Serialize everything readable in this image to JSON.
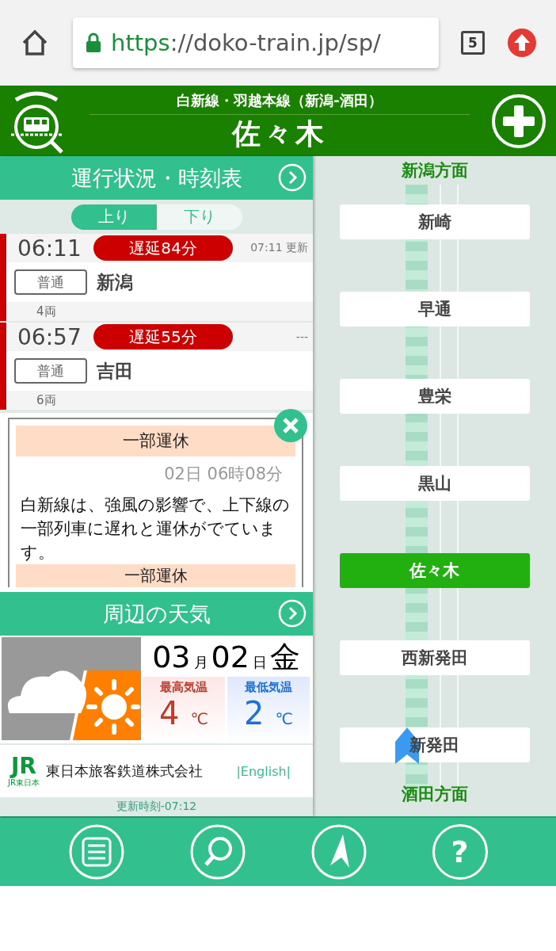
{
  "browser": {
    "url_scheme": "https",
    "url_rest": "://doko-train.jp/sp/",
    "tab_count": "5"
  },
  "header": {
    "line": "白新線・羽越本線（新潟-酒田）",
    "station": "佐々木"
  },
  "timetable": {
    "title": "運行状況・時刻表",
    "directions": [
      {
        "label": "上り",
        "selected": true
      },
      {
        "label": "下り",
        "selected": false
      }
    ],
    "trains": [
      {
        "time": "06:11",
        "delay": "遅延84分",
        "delayed": true,
        "updated": "07:11 更新",
        "type": "普通",
        "destination": "新潟",
        "cars": "4両"
      },
      {
        "time": "06:57",
        "delay": "遅延55分",
        "delayed": true,
        "updated": "---",
        "type": "普通",
        "destination": "吉田",
        "cars": "6両"
      }
    ]
  },
  "notice": {
    "title": "一部運休",
    "date": "02日 06時08分",
    "text": "白新線は、強風の影響で、上下線の一部列車に遅れと運休がでています。",
    "next_title": "一部運休"
  },
  "weather": {
    "title": "周辺の天気",
    "month": "03",
    "month_unit": "月",
    "day": "02",
    "day_unit": "日",
    "weekday": "金",
    "high_label": "最高気温",
    "high": "4",
    "low_label": "最低気温",
    "low": "2",
    "unit": "℃"
  },
  "footer": {
    "logo": "JR",
    "logo_caption": "JR東日本",
    "company": "東日本旅客鉄道株式会社",
    "english": "|English|",
    "updated": "更新時刻-07:12"
  },
  "line_map": {
    "top_direction": "新潟方面",
    "bottom_direction": "酒田方面",
    "stations": [
      {
        "name": "新崎",
        "selected": false,
        "train": false
      },
      {
        "name": "早通",
        "selected": false,
        "train": false
      },
      {
        "name": "豊栄",
        "selected": false,
        "train": false
      },
      {
        "name": "黒山",
        "selected": false,
        "train": false
      },
      {
        "name": "佐々木",
        "selected": true,
        "train": false
      },
      {
        "name": "西新発田",
        "selected": false,
        "train": false
      },
      {
        "name": "新発田",
        "selected": false,
        "train": true
      }
    ]
  },
  "nav": [
    {
      "kind": "menu"
    },
    {
      "kind": "search"
    },
    {
      "kind": "locate"
    },
    {
      "kind": "help",
      "label": "?"
    }
  ]
}
